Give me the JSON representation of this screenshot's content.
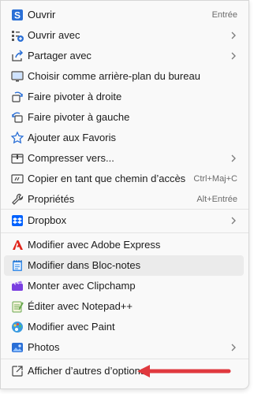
{
  "menu": {
    "items": [
      {
        "label": "Ouvrir",
        "shortcut": "Entrée",
        "icon": "open-icon"
      },
      {
        "label": "Ouvrir avec",
        "icon": "open-with-icon",
        "submenu": true
      },
      {
        "label": "Partager avec",
        "icon": "share-icon",
        "submenu": true
      },
      {
        "label": "Choisir comme arrière-plan du bureau",
        "icon": "desktop-background-icon"
      },
      {
        "label": "Faire pivoter à droite",
        "icon": "rotate-right-icon"
      },
      {
        "label": "Faire pivoter à gauche",
        "icon": "rotate-left-icon"
      },
      {
        "label": "Ajouter aux Favoris",
        "icon": "star-icon"
      },
      {
        "label": "Compresser vers...",
        "icon": "archive-icon",
        "submenu": true
      },
      {
        "label": "Copier en tant que chemin d’accès",
        "shortcut": "Ctrl+Maj+C",
        "icon": "copy-path-icon"
      },
      {
        "label": "Propriétés",
        "shortcut": "Alt+Entrée",
        "icon": "wrench-icon"
      },
      {
        "label": "Dropbox",
        "icon": "dropbox-icon",
        "submenu": true
      },
      {
        "label": "Modifier avec Adobe Express",
        "icon": "adobe-express-icon"
      },
      {
        "label": "Modifier dans Bloc-notes",
        "icon": "notepad-icon"
      },
      {
        "label": "Monter avec Clipchamp",
        "icon": "clipchamp-icon"
      },
      {
        "label": "Éditer avec Notepad++",
        "icon": "notepad-plus-plus-icon"
      },
      {
        "label": "Modifier avec Paint",
        "icon": "paint-icon"
      },
      {
        "label": "Photos",
        "icon": "photos-icon",
        "submenu": true
      },
      {
        "label": "Afficher d’autres d’options",
        "icon": "more-options-icon"
      }
    ]
  },
  "colors": {
    "menu_background": "#f9f9f9",
    "hover_background": "#ebebeb",
    "arrow": "#e0393e",
    "accent_blue": "#2a6fd6"
  }
}
